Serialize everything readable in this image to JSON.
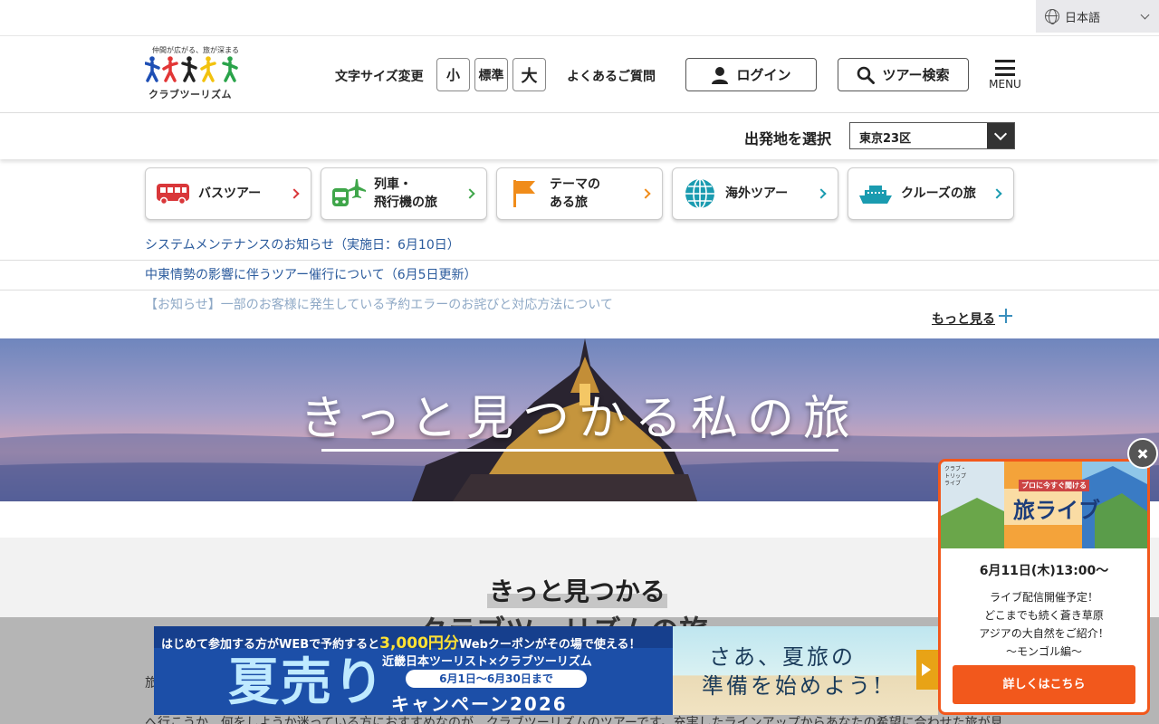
{
  "language": {
    "selected": "日本語"
  },
  "logo": {
    "tagline": "仲間が広がる、旅が深まる",
    "brand": "クラブツーリズム"
  },
  "header": {
    "font_size_label": "文字サイズ変更",
    "font_sizes": [
      "小",
      "標準",
      "大"
    ],
    "faq": "よくあるご質問",
    "login": "ログイン",
    "tour_search": "ツアー検索",
    "menu": "MENU"
  },
  "departure": {
    "label": "出発地を選択",
    "selected": "東京23区"
  },
  "categories": [
    {
      "label": "バスツアー",
      "color": "#d9373a",
      "icon": "bus-icon"
    },
    {
      "label": "列車・\n飛行機の旅",
      "color": "#3fa64a",
      "icon": "train-plane-icon"
    },
    {
      "label": "テーマの\nある旅",
      "color": "#f08c1a",
      "icon": "flag-icon"
    },
    {
      "label": "海外ツアー",
      "color": "#1a9bb0",
      "icon": "globe-icon"
    },
    {
      "label": "クルーズの旅",
      "color": "#1a9bb0",
      "icon": "ship-icon"
    }
  ],
  "notices": [
    {
      "text": "システムメンテナンスのお知らせ（実施日：6月10日）"
    },
    {
      "text": "中東情勢の影響に伴うツアー催行について（6月5日更新）"
    },
    {
      "text": "【お知らせ】一部のお客様に発生している予約エラーのお詫びと対応方法について"
    }
  ],
  "more_label": "もっと見る",
  "hero": {
    "title": "きっと見つかる私の旅"
  },
  "intro": {
    "heading1": "きっと見つかる",
    "heading2": "クラブツーリズムの旅",
    "para1": "旅",
    "para2": "へ行こうか、何をしようか迷っている方におすすめなのが、クラブツーリズムのツアーです。充実したラインアップからあなたの希望に合わせた旅が見"
  },
  "banner": {
    "top_pre": "はじめて参加する方がWEBで予約すると",
    "top_highlight": "3,000円分",
    "top_post": "Webクーポンがその場で使える！",
    "sub": "近畿日本ツーリスト×クラブツーリズム",
    "big": "夏売り",
    "date": "6月1日〜6月30日まで",
    "campaign": "キャンペーン2026",
    "right_line1": "さあ、夏旅の",
    "right_line2": "準備を始めよう!"
  },
  "popup": {
    "image_label": "旅ライブ",
    "image_caption": "プロに今すぐ聞ける",
    "datetime": "6月11日(木)13:00～",
    "lines": [
      "ライブ配信開催予定！",
      "どこまでも続く蒼き草原",
      "アジアの大自然をご紹介！",
      "～モンゴル編～"
    ],
    "cta": "詳しくはこちら"
  },
  "colors": {
    "accent": "#f2581c",
    "link": "#2a5a9c",
    "banner_blue": "#1c4fa8"
  }
}
